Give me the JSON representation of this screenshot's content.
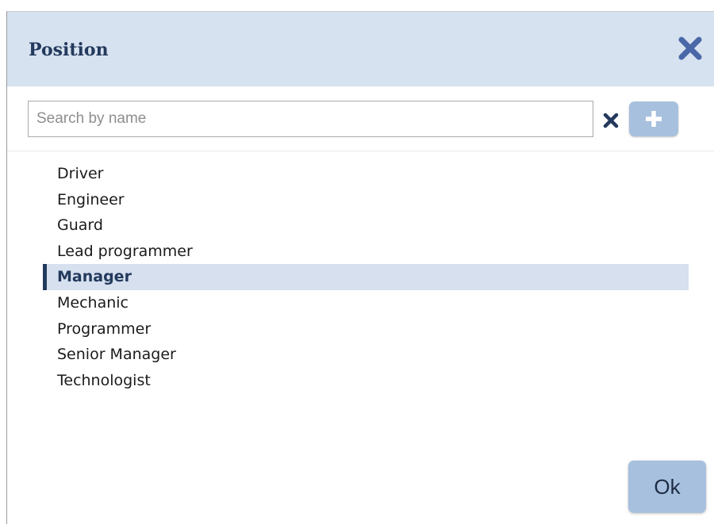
{
  "dialog": {
    "title": "Position",
    "close_icon": "close-icon"
  },
  "search": {
    "placeholder": "Search by name",
    "value": "",
    "clear_icon": "clear-icon",
    "add_icon": "plus-icon"
  },
  "list": {
    "items": [
      {
        "label": "Driver",
        "selected": false
      },
      {
        "label": "Engineer",
        "selected": false
      },
      {
        "label": "Guard",
        "selected": false
      },
      {
        "label": "Lead programmer",
        "selected": false
      },
      {
        "label": "Manager",
        "selected": true
      },
      {
        "label": "Mechanic",
        "selected": false
      },
      {
        "label": "Programmer",
        "selected": false
      },
      {
        "label": "Senior Manager",
        "selected": false
      },
      {
        "label": "Technologist",
        "selected": false
      }
    ]
  },
  "footer": {
    "ok_label": "Ok"
  },
  "colors": {
    "header_bg": "#d7e2f0",
    "title": "#23395d",
    "accent_button": "#a7c0de",
    "selection_bg": "#d6e0ee",
    "selection_marker": "#23395d",
    "close_icon": "#4a67a8"
  }
}
